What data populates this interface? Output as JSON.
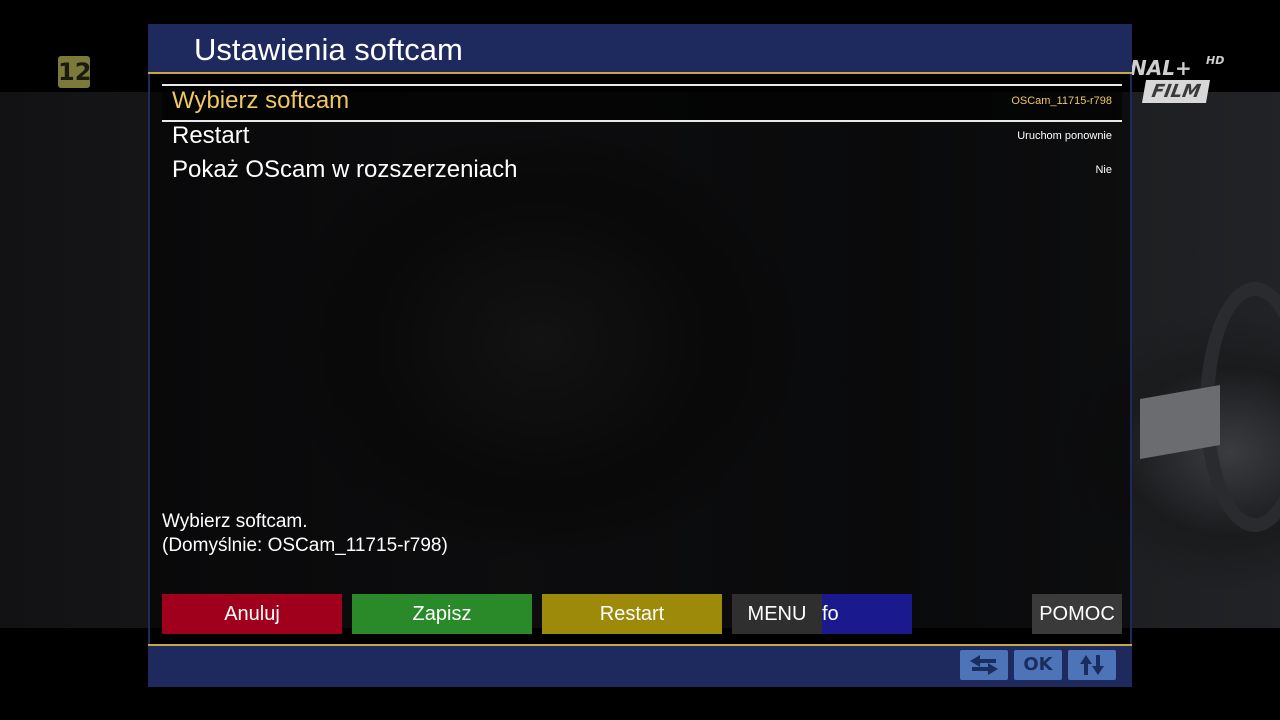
{
  "channel": {
    "number": "12",
    "logo_line1": "NAL+",
    "logo_hd": "HD",
    "logo_line2": "FILM"
  },
  "dialog": {
    "title": "Ustawienia softcam",
    "items": [
      {
        "label": "Wybierz softcam",
        "value": "OSCam_11715-r798",
        "selected": true
      },
      {
        "label": "Restart",
        "value": "Uruchom ponownie",
        "selected": false
      },
      {
        "label": "Pokaż OScam w rozszerzeniach",
        "value": "Nie",
        "selected": false
      }
    ],
    "description_line1": "Wybierz softcam.",
    "description_line2": "(Domyślnie: OSCam_11715-r798)",
    "buttons": {
      "red": "Anuluj",
      "green": "Zapisz",
      "yellow": "Restart",
      "menu": "MENU",
      "blue": "fo",
      "help": "POMOC"
    },
    "footer_keys": {
      "ok": "OK",
      "left_right_icon": "left-right-arrows-icon",
      "up_down_icon": "up-down-arrows-icon"
    }
  },
  "colors": {
    "title_bar": "#1e2a5e",
    "accent_gold": "#c8a640",
    "selected_text": "#f0c860",
    "red": "#a1001c",
    "green": "#2a8a2a",
    "yellow": "#9e8a0a",
    "blue": "#1a1a8e"
  }
}
